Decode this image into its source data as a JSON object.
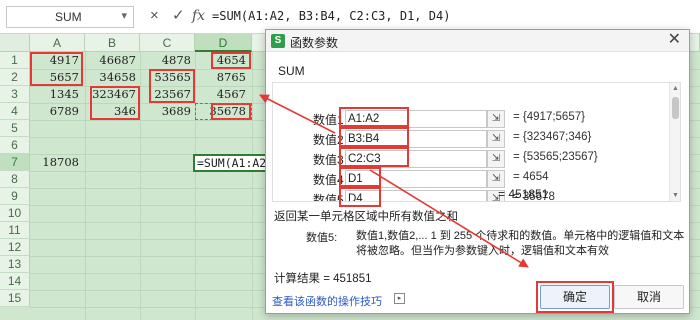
{
  "formula_bar": {
    "name_box": "SUM",
    "name_box_caret": "▾",
    "cancel_icon": "×",
    "confirm_icon": "✓",
    "fx_label": "fx",
    "formula": "=SUM(A1:A2, B3:B4, C2:C3, D1, D4)"
  },
  "sheet": {
    "columns": [
      "A",
      "B",
      "C",
      "D"
    ],
    "rows": [
      "1",
      "2",
      "3",
      "4",
      "5",
      "6",
      "7",
      "8",
      "9",
      "10",
      "11",
      "12",
      "13",
      "14",
      "15"
    ],
    "cells": {
      "A1": "4917",
      "B1": "46687",
      "C1": "4878",
      "D1": "4654",
      "A2": "5657",
      "B2": "34658",
      "C2": "53565",
      "D2": "8765",
      "A3": "1345",
      "B3": "323467",
      "C3": "23567",
      "D3": "4567",
      "A4": "6789",
      "B4": "346",
      "C4": "3689",
      "D4": "35678",
      "A7": "18708",
      "D7": "=SUM(A1:A2,"
    }
  },
  "dialog": {
    "logo": "S",
    "title": "函数参数",
    "close_icon": "✕",
    "function_name": "SUM",
    "args": [
      {
        "label": "数值1",
        "value": "A1:A2",
        "result": "= {4917;5657}"
      },
      {
        "label": "数值2",
        "value": "B3:B4",
        "result": "= {323467;346}"
      },
      {
        "label": "数值3",
        "value": "C2:C3",
        "result": "= {53565;23567}"
      },
      {
        "label": "数值4",
        "value": "D1",
        "result": "= 4654"
      },
      {
        "label": "数值5",
        "value": "D4",
        "result": "= 35678"
      }
    ],
    "picker_icon": "⇲",
    "scroll_up": "▲",
    "scroll_down": "▼",
    "total": "= 451851",
    "description": "返回某一单元格区域中所有数值之和",
    "param_label": "数值5:",
    "param_desc": "数值1,数值2,... 1 到 255 个待求和的数值。单元格中的逻辑值和文本将被忽略。但当作为参数键入时，逻辑值和文本有效",
    "calc_result": "计算结果 = 451851",
    "help_link": "查看该函数的操作技巧",
    "help_icon": "▸",
    "ok_label": "确定",
    "cancel_label": "取消"
  },
  "colors": {
    "sheet_bg": "#cfe6cf",
    "highlight_red": "#e53935",
    "active_green": "#2e7d32",
    "link_blue": "#2a56c6"
  }
}
